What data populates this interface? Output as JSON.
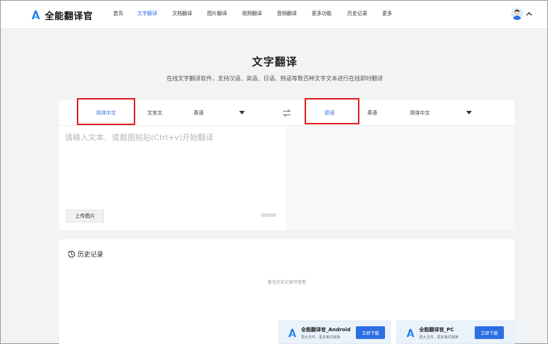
{
  "app": {
    "name": "全能翻译官"
  },
  "nav": {
    "items": [
      {
        "label": "首页"
      },
      {
        "label": "文字翻译"
      },
      {
        "label": "文档翻译"
      },
      {
        "label": "图片翻译"
      },
      {
        "label": "视频翻译"
      },
      {
        "label": "音频翻译"
      },
      {
        "label": "更多功能"
      },
      {
        "label": "历史记录"
      },
      {
        "label": "更多"
      }
    ],
    "active": "文字翻译"
  },
  "page": {
    "title": "文字翻译",
    "subtitle": "在线文字翻译软件，支持汉语、英语、日语、韩语等数百种文字文本进行在线即时翻译"
  },
  "translator": {
    "source_langs": [
      "简体中文",
      "文言文",
      "英语"
    ],
    "source_active": "简体中文",
    "target_langs": [
      "德语",
      "英语",
      "简体中文"
    ],
    "target_active": "德语",
    "input": {
      "placeholder": "请输入文本、或截图粘贴(Ctrl+v)开始翻译",
      "value": ""
    },
    "upload_label": "上传图片",
    "char_count": "0/5000"
  },
  "history": {
    "title": "历史记录",
    "empty_text": "暂无历史记录可查看"
  },
  "downloads": [
    {
      "name": "全能翻译官_Android",
      "desc": "更大文件、更多格式转换",
      "button": "立即下载"
    },
    {
      "name": "全能翻译官_PC",
      "desc": "更大文件、更多格式转换",
      "button": "立即下载"
    }
  ],
  "colors": {
    "accent": "#2f6fe4",
    "highlight": "#e21b1b",
    "page_bg": "#f2f3f5"
  },
  "icons": [
    "app-logo-icon",
    "avatar-icon",
    "chevron-up-icon",
    "swap-icon",
    "dropdown-caret-icon",
    "history-clock-icon",
    "download-app-logo-icon"
  ]
}
